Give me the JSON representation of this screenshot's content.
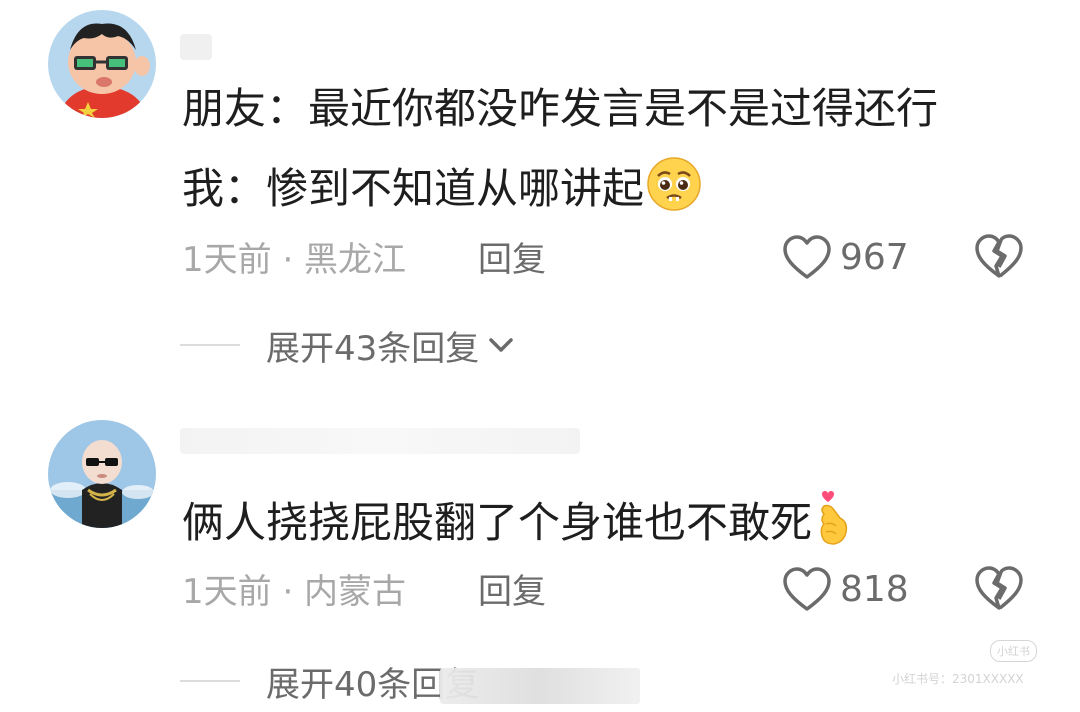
{
  "comments": [
    {
      "text_line1": "朋友：最近你都没咋发言是不是过得还行",
      "text_line2": "我：惨到不知道从哪讲起",
      "emoji": "pleading-face",
      "time_location": "1天前 · 黑龙江",
      "reply_label": "回复",
      "like_count": "967",
      "expand_label": "展开43条回复"
    },
    {
      "text_line1": "俩人挠挠屁股翻了个身谁也不敢死",
      "emoji": "finger-heart",
      "time_location": "1天前 · 内蒙古",
      "reply_label": "回复",
      "like_count": "818",
      "expand_label": "展开40条回复"
    }
  ],
  "watermark": {
    "logo_text": "小红书",
    "id_text": "小红书号：2301XXXXX"
  },
  "colors": {
    "text_primary": "#1e1e1e",
    "text_meta": "#a8a8a8",
    "text_secondary": "#6b6b6b",
    "divider": "#dcdcdc"
  }
}
